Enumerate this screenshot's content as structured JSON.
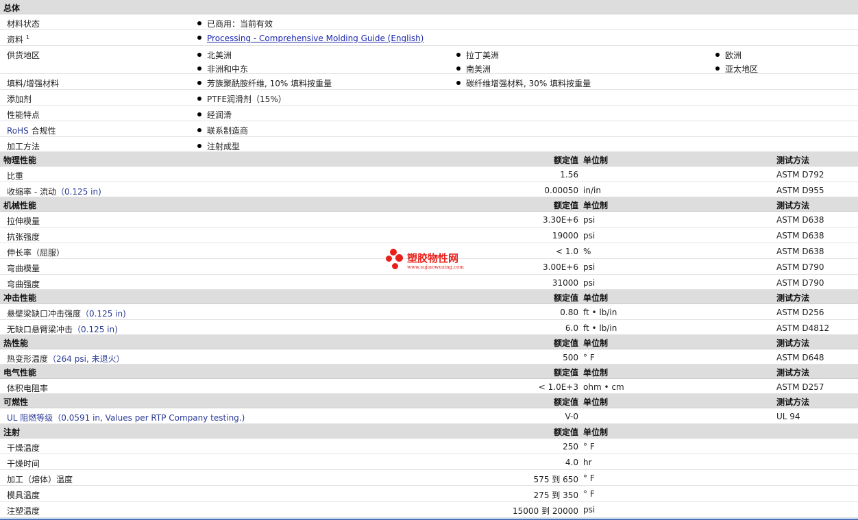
{
  "general": {
    "title": "总体",
    "status": {
      "label": "材料状态",
      "value": "已商用：当前有效"
    },
    "docs": {
      "label": "资料",
      "sup": "1",
      "link": "Processing - Comprehensive Molding Guide (English)"
    },
    "regions": {
      "label": "供货地区",
      "items": [
        "北美洲",
        "拉丁美洲",
        "欧洲",
        "非洲和中东",
        "南美洲",
        "亚太地区"
      ]
    },
    "filler": {
      "label": "填料/增强材料",
      "items": [
        "芳族聚酰胺纤维, 10% 填料按重量",
        "碳纤维增强材料, 30% 填料按重量"
      ]
    },
    "additive": {
      "label": "添加剂",
      "value": "PTFE润滑剂（15%）"
    },
    "features": {
      "label": "性能特点",
      "value": "经润滑"
    },
    "rohs": {
      "label_a": "RoHS",
      "label_b": " 合规性",
      "value": "联系制造商"
    },
    "process": {
      "label": "加工方法",
      "value": "注射成型"
    }
  },
  "headers": {
    "value": "额定值",
    "unit": "单位制",
    "method": "测试方法"
  },
  "sections": {
    "physical": {
      "title": "物理性能",
      "rows": [
        {
          "label": "比重",
          "value": "1.56",
          "unit": "",
          "method": "ASTM D792"
        },
        {
          "label": "收缩率 - 流动",
          "cond": "（0.125 in)",
          "value": "0.00050",
          "unit": "in/in",
          "method": "ASTM D955"
        }
      ]
    },
    "mechanical": {
      "title": "机械性能",
      "rows": [
        {
          "label": "拉伸模量",
          "value": "3.30E+6",
          "unit": "psi",
          "method": "ASTM D638"
        },
        {
          "label": "抗张强度",
          "value": "19000",
          "unit": "psi",
          "method": "ASTM D638"
        },
        {
          "label": "伸长率（屈服）",
          "value": "< 1.0",
          "unit": "%",
          "method": "ASTM D638"
        },
        {
          "label": "弯曲模量",
          "value": "3.00E+6",
          "unit": "psi",
          "method": "ASTM D790"
        },
        {
          "label": "弯曲强度",
          "value": "31000",
          "unit": "psi",
          "method": "ASTM D790"
        }
      ]
    },
    "impact": {
      "title": "冲击性能",
      "rows": [
        {
          "label": "悬壁梁缺口冲击强度",
          "cond": "（0.125 in)",
          "value": "0.80",
          "unit": "ft • lb/in",
          "method": "ASTM D256"
        },
        {
          "label": "无缺口悬臂梁冲击",
          "cond": "（0.125 in)",
          "value": "6.0",
          "unit": "ft • lb/in",
          "method": "ASTM D4812"
        }
      ]
    },
    "thermal": {
      "title": "热性能",
      "rows": [
        {
          "label": "热变形温度",
          "cond": "（264 psi, 未退火）",
          "value": "500",
          "unit": "° F",
          "method": "ASTM D648"
        }
      ]
    },
    "electrical": {
      "title": "电气性能",
      "rows": [
        {
          "label": "体积电阻率",
          "value": "< 1.0E+3",
          "unit": "ohm • cm",
          "method": "ASTM D257"
        }
      ]
    },
    "flammability": {
      "title": "可燃性",
      "rows": [
        {
          "label": "UL 阻燃等级",
          "cond": "（0.0591 in, Values per RTP Company testing.)",
          "value": "V-0",
          "unit": "",
          "method": "UL 94"
        }
      ]
    },
    "injection": {
      "title": "注射",
      "rows": [
        {
          "label": "干燥温度",
          "value": "250",
          "unit": "° F"
        },
        {
          "label": "干燥时间",
          "value": "4.0",
          "unit": "hr"
        },
        {
          "label": "加工（熔体）温度",
          "value": "575 到  650",
          "unit": "° F"
        },
        {
          "label": "模具温度",
          "value": "275 到  350",
          "unit": "° F"
        },
        {
          "label": "注塑温度",
          "value": "15000 到  20000",
          "unit": "psi"
        }
      ]
    }
  },
  "watermark": {
    "text": "塑胶物性网",
    "url": "www.sujiaowuxing.com"
  },
  "colors": {
    "section_bg": "#dddddd",
    "link": "#1a25b0",
    "label_blue": "#2a3a96",
    "watermark": "#e8201b"
  }
}
